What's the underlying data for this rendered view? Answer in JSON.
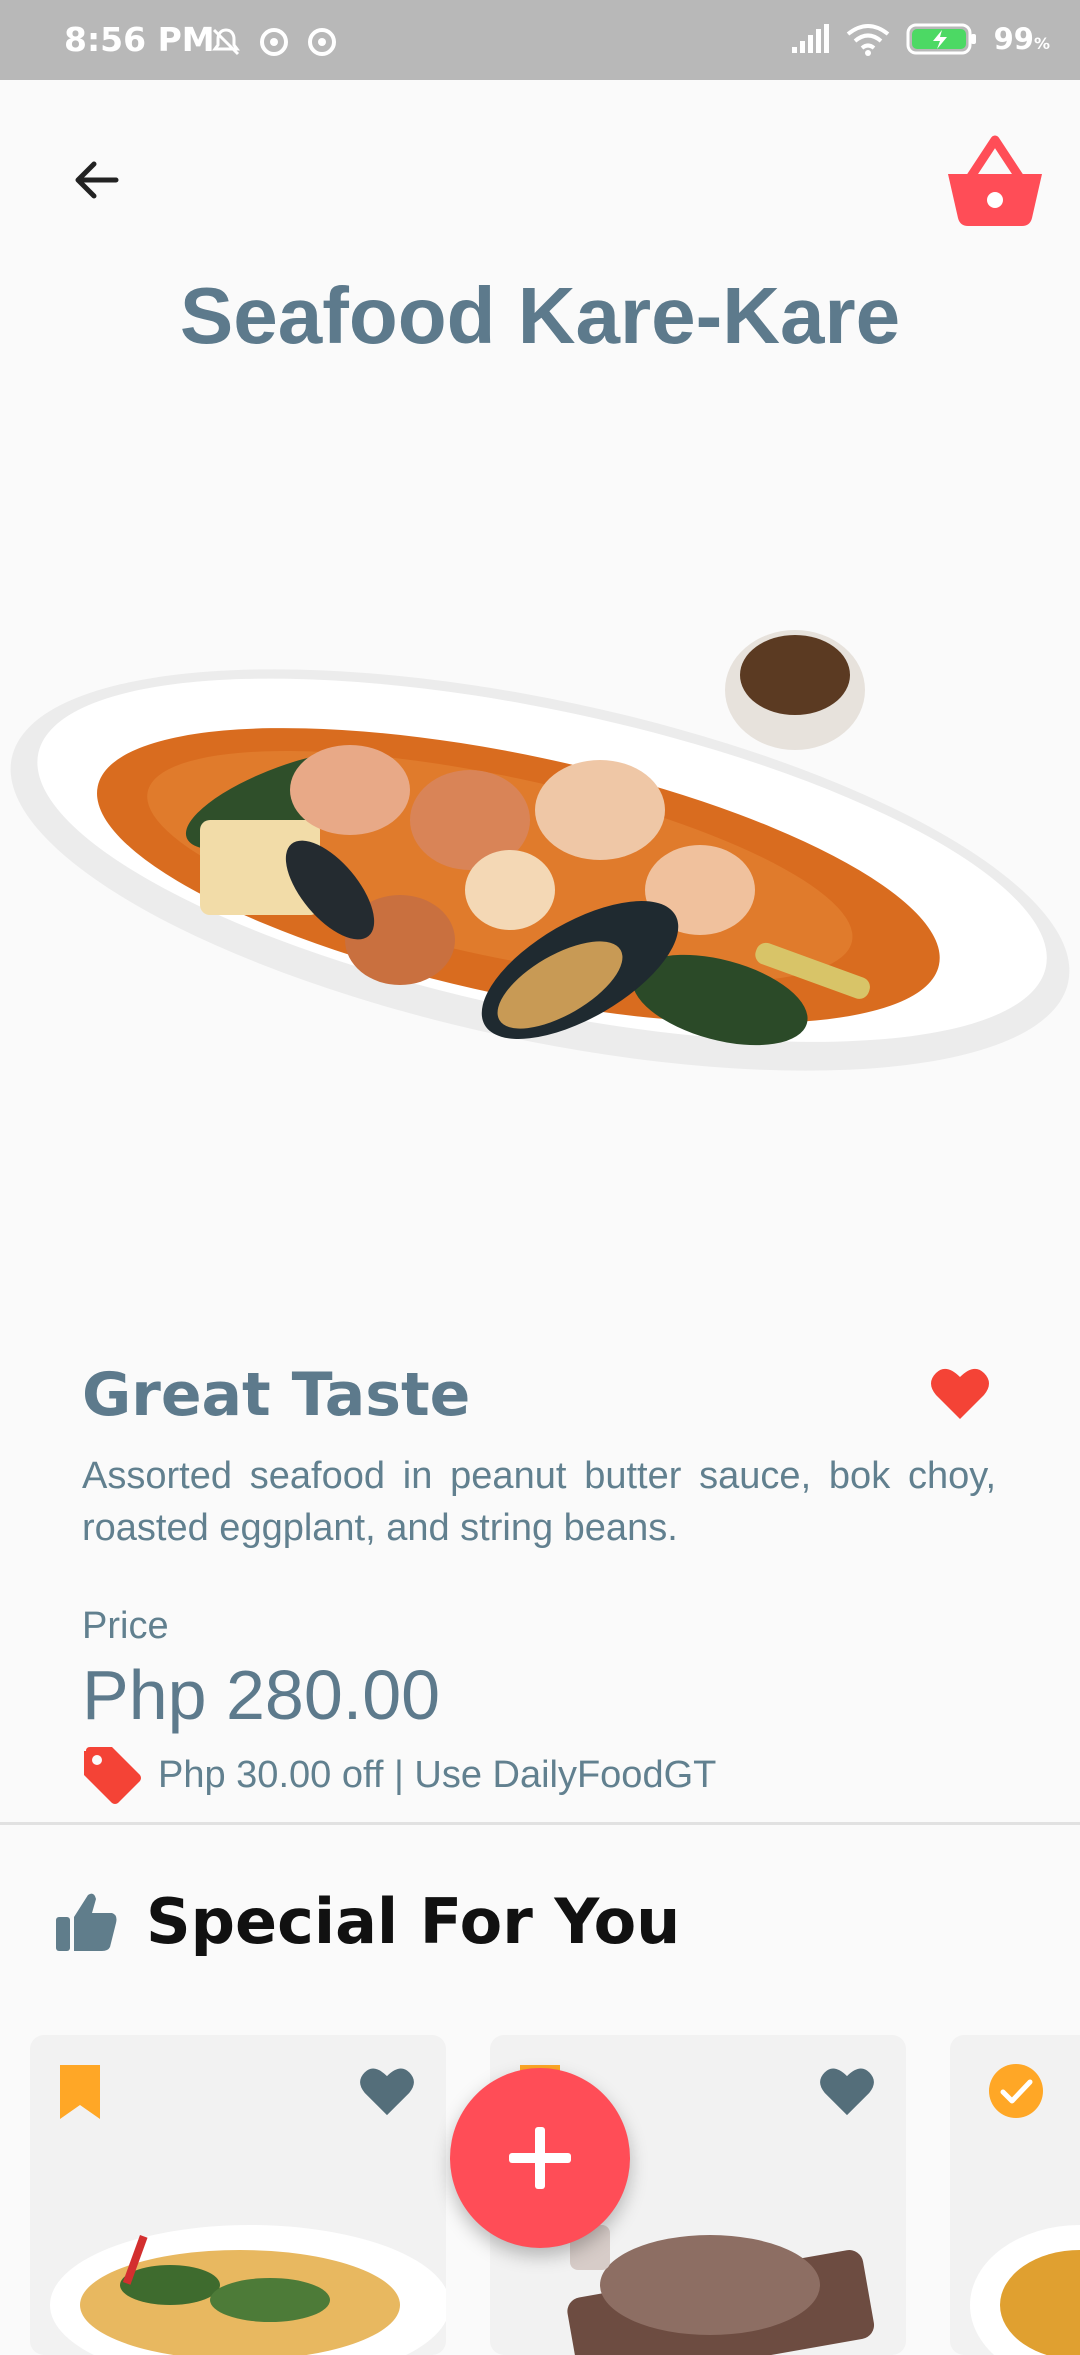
{
  "status_bar": {
    "time": "8:56 PM",
    "battery": "99",
    "battery_unit": "%",
    "icons": [
      "silent-bell-icon",
      "alarm-icon",
      "alarm-icon",
      "signal-icon",
      "wifi-icon",
      "battery-charging-icon"
    ]
  },
  "header": {
    "title": "Seafood Kare-Kare",
    "back_icon": "arrow-left-icon",
    "basket_icon": "basket-icon"
  },
  "product": {
    "tagline": "Great Taste",
    "description": "Assorted seafood in peanut butter sauce, bok choy, roasted eggplant, and string beans.",
    "price_label": "Price",
    "price": "Php 280.00",
    "promo": "Php 30.00 off | Use DailyFoodGT",
    "favorite_icon": "heart-icon"
  },
  "special": {
    "title": "Special For You",
    "icon": "thumbs-up-icon"
  },
  "colors": {
    "accent": "#ff4d57",
    "text": "#607d8b",
    "orange": "#ffa726"
  }
}
